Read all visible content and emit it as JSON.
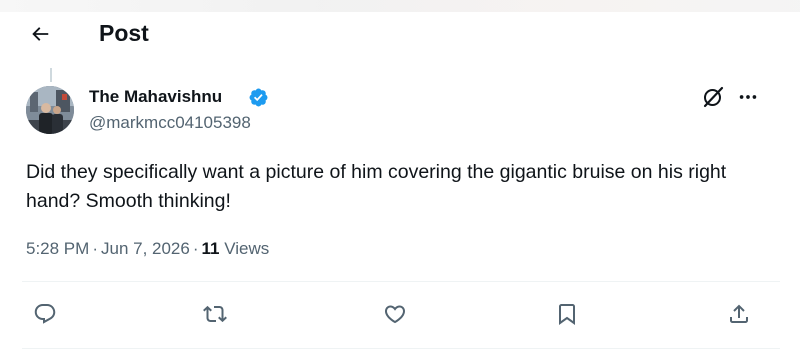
{
  "header": {
    "title": "Post",
    "back_icon": "arrow-left-icon"
  },
  "post": {
    "author": {
      "display_name": "The Mahavishnu",
      "handle": "@markmcc04105398",
      "verified": true,
      "verified_color": "#1d9bf0"
    },
    "text": "Did they specifically want a picture of him covering the gigantic bruise on his right hand? Smooth thinking!",
    "meta": {
      "time": "5:28 PM",
      "date": "Jun 7, 2026",
      "views_count": "11",
      "views_label": "Views"
    }
  },
  "actions": [
    {
      "name": "reply",
      "icon": "reply-icon"
    },
    {
      "name": "repost",
      "icon": "repost-icon"
    },
    {
      "name": "like",
      "icon": "heart-icon"
    },
    {
      "name": "bookmark",
      "icon": "bookmark-icon"
    },
    {
      "name": "share",
      "icon": "share-icon"
    }
  ],
  "colors": {
    "text_primary": "#0f1419",
    "text_secondary": "#536471",
    "divider": "#eff3f4"
  }
}
